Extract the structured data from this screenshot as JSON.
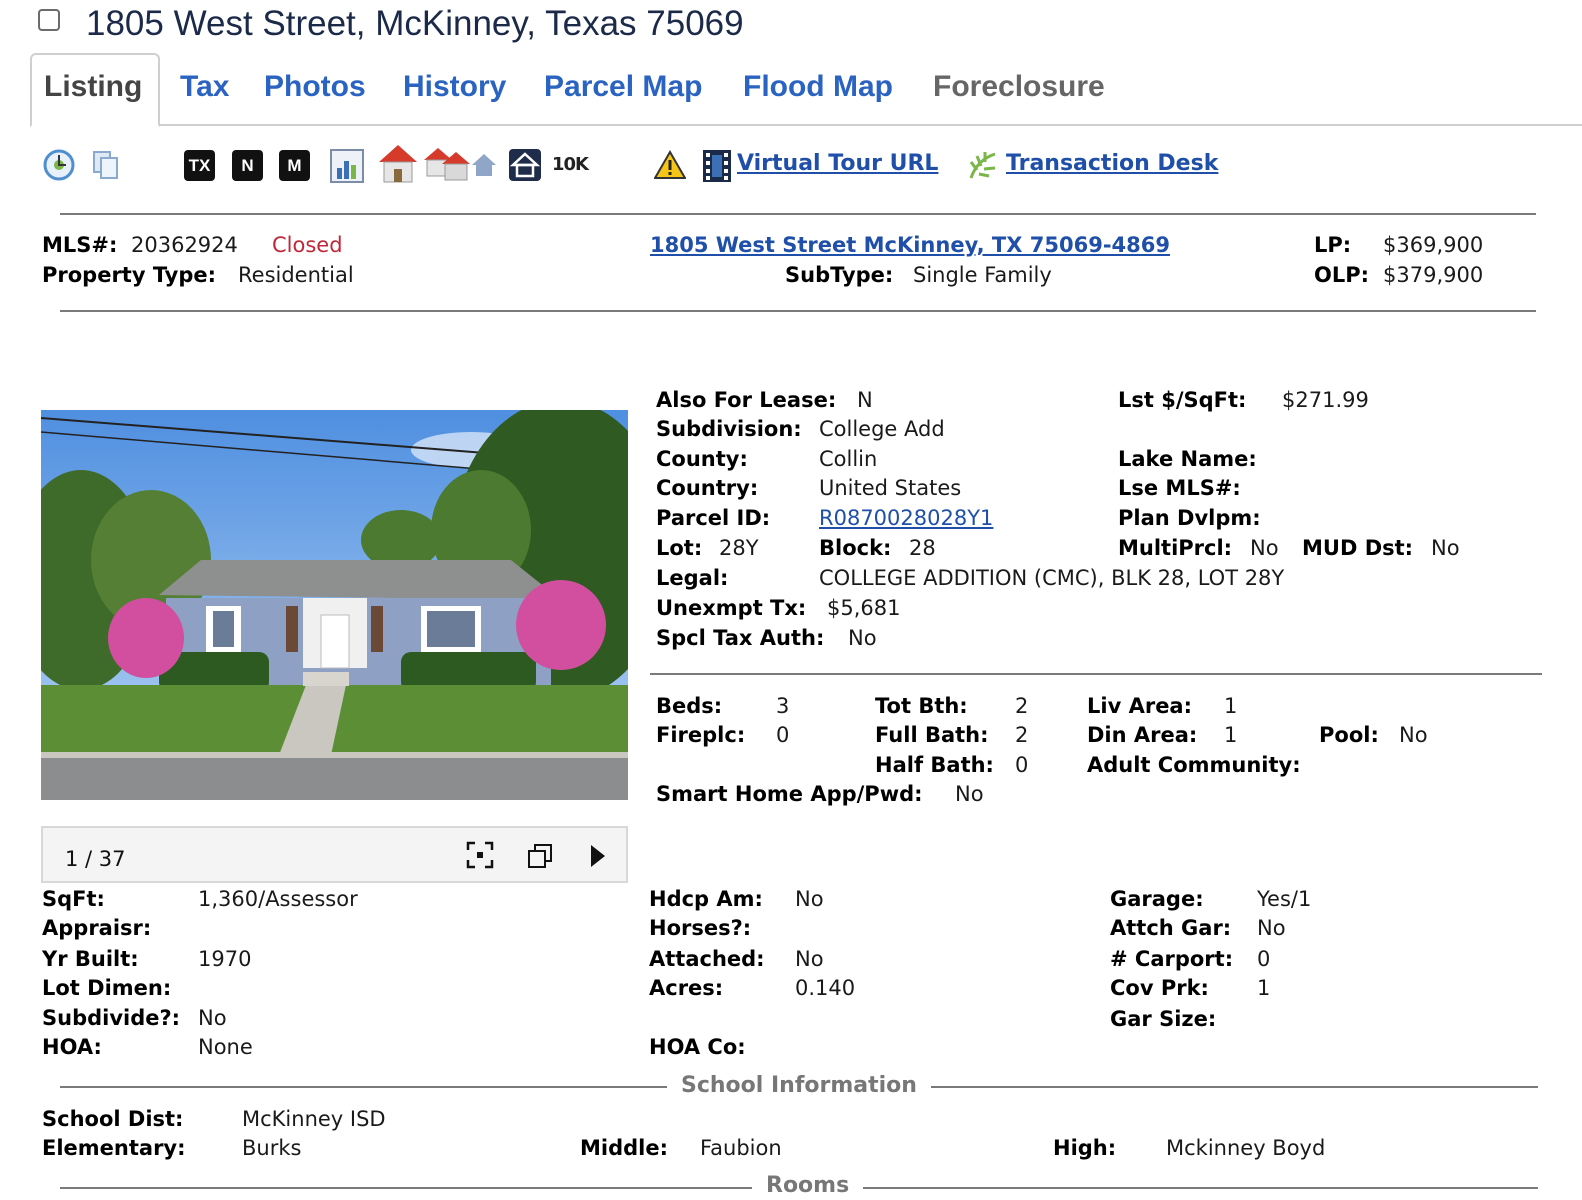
{
  "header": {
    "title": "1805 West Street, McKinney, Texas 75069"
  },
  "tabs": [
    "Listing",
    "Tax",
    "Photos",
    "History",
    "Parcel Map",
    "Flood Map",
    "Foreclosure"
  ],
  "toolbar": {
    "box_icons": [
      "TX",
      "N",
      "M"
    ],
    "tenk": "10K",
    "virtual_tour": "Virtual Tour URL",
    "transaction_desk": "Transaction Desk"
  },
  "summary": {
    "mls_label": "MLS#:",
    "mls": "20362924",
    "status": "Closed",
    "status_color": "#c0283a",
    "ptype_label": "Property Type:",
    "ptype": "Residential",
    "address": "1805 West Street McKinney, TX 75069-4869",
    "subtype_label": "SubType:",
    "subtype": "Single Family",
    "lp_label": "LP:",
    "lp": "$369,900",
    "olp_label": "OLP:",
    "olp": "$379,900"
  },
  "details": {
    "also_lease_label": "Also For Lease:",
    "also_lease": "N",
    "lst_sqft_label": "Lst $/SqFt:",
    "lst_sqft": "$271.99",
    "subdivision_label": "Subdivision:",
    "subdivision": "College Add",
    "county_label": "County:",
    "county": "Collin",
    "lake_label": "Lake Name:",
    "country_label": "Country:",
    "country": "United States",
    "lse_mls_label": "Lse MLS#:",
    "parcel_label": "Parcel ID:",
    "parcel": "R0870028028Y1",
    "plan_label": "Plan Dvlpm:",
    "lot_label": "Lot:",
    "lot": "28Y",
    "block_label": "Block:",
    "block": "28",
    "multiprcl_label": "MultiPrcl:",
    "multiprcl": "No",
    "mud_label": "MUD Dst:",
    "mud": "No",
    "legal_label": "Legal:",
    "legal": "COLLEGE ADDITION (CMC), BLK 28, LOT 28Y",
    "unexmpt_label": "Unexmpt Tx:",
    "unexmpt": "$5,681",
    "spcl_label": "Spcl Tax Auth:",
    "spcl": "No"
  },
  "rooms": {
    "beds_label": "Beds:",
    "beds": "3",
    "totbth_label": "Tot Bth:",
    "totbth": "2",
    "liv_label": "Liv Area:",
    "liv": "1",
    "fireplc_label": "Fireplc:",
    "fireplc": "0",
    "fullbath_label": "Full Bath:",
    "fullbath": "2",
    "din_label": "Din Area:",
    "din": "1",
    "pool_label": "Pool:",
    "pool": "No",
    "halfbath_label": "Half Bath:",
    "halfbath": "0",
    "adult_label": "Adult Community:",
    "smart_label": "Smart Home App/Pwd:",
    "smart": "No"
  },
  "photo": {
    "counter": "1 / 37"
  },
  "features": {
    "sqft_label": "SqFt:",
    "sqft": "1,360/Assessor",
    "appraisr_label": "Appraisr:",
    "yrbuilt_label": "Yr Built:",
    "yrbuilt": "1970",
    "lotdimen_label": "Lot Dimen:",
    "subdivide_label": "Subdivide?:",
    "subdivide": "No",
    "hoa_label": "HOA:",
    "hoa": "None",
    "hdcp_label": "Hdcp Am:",
    "hdcp": "No",
    "horses_label": "Horses?:",
    "attached_label": "Attached:",
    "attached": "No",
    "acres_label": "Acres:",
    "acres": "0.140",
    "hoaco_label": "HOA Co:",
    "garage_label": "Garage:",
    "garage": "Yes/1",
    "attchgar_label": "Attch Gar:",
    "attchgar": "No",
    "carport_label": "# Carport:",
    "carport": "0",
    "covprk_label": "Cov Prk:",
    "covprk": "1",
    "garsize_label": "Gar Size:"
  },
  "school": {
    "heading": "School Information",
    "dist_label": "School Dist:",
    "dist": "McKinney ISD",
    "elem_label": "Elementary:",
    "elem": "Burks",
    "middle_label": "Middle:",
    "middle": "Faubion",
    "high_label": "High:",
    "high": "Mckinney Boyd"
  },
  "rooms_heading": "Rooms"
}
